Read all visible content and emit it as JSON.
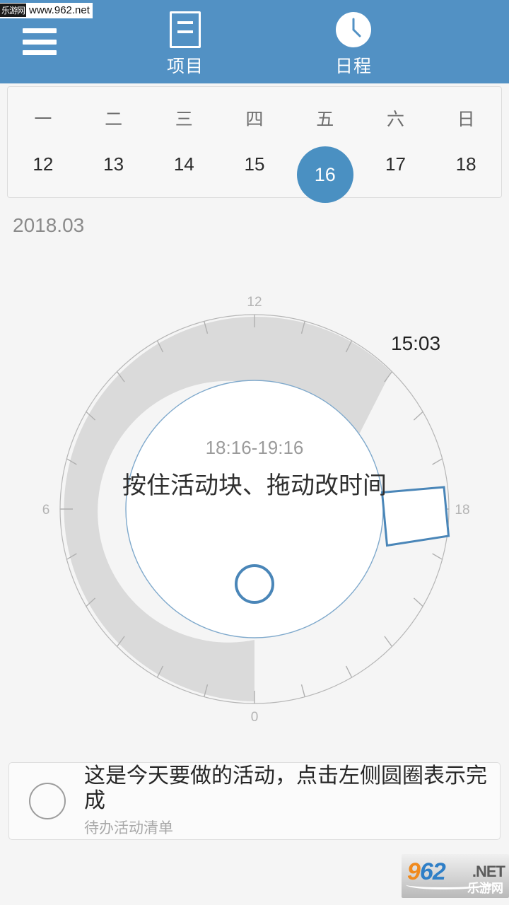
{
  "header": {
    "background_color": "#5291c4",
    "menu_icon": "hamburger-menu-icon",
    "tabs": [
      {
        "id": "projects",
        "label": "项目",
        "icon": "document-icon",
        "active": false
      },
      {
        "id": "schedule",
        "label": "日程",
        "icon": "clock-icon",
        "active": true
      }
    ]
  },
  "calendar": {
    "weekdays": [
      "一",
      "二",
      "三",
      "四",
      "五",
      "六",
      "日"
    ],
    "days": [
      "12",
      "13",
      "14",
      "15",
      "16",
      "17",
      "18"
    ],
    "selected_day": "16",
    "selected_color": "#4a90c2"
  },
  "month_label": "2018.03",
  "dial": {
    "now_label": "15:03",
    "center_time_range": "18:16-19:16",
    "center_hint": "按住活动块、拖动改时间",
    "hour_labels": [
      "0",
      "6",
      "12",
      "18"
    ],
    "elapsed_arc_color": "#dadada",
    "ring_color": "#b6b6b6",
    "inner_circle_stroke": "#7fa9cc",
    "activity_block_color": "#4a86b8",
    "add_button_icon": "circle-outline-icon"
  },
  "todo": {
    "title": "这是今天要做的活动，点击左侧圆圈表示完成",
    "subtitle": "待办活动清单",
    "checkbox_icon": "circle-checkbox-icon"
  },
  "watermarks": {
    "top_badge": "乐游网",
    "top_url": "www.962.net",
    "logo_num_first": "9",
    "logo_num_rest": "62",
    "logo_net": ".NET",
    "logo_cn": "乐游网"
  }
}
